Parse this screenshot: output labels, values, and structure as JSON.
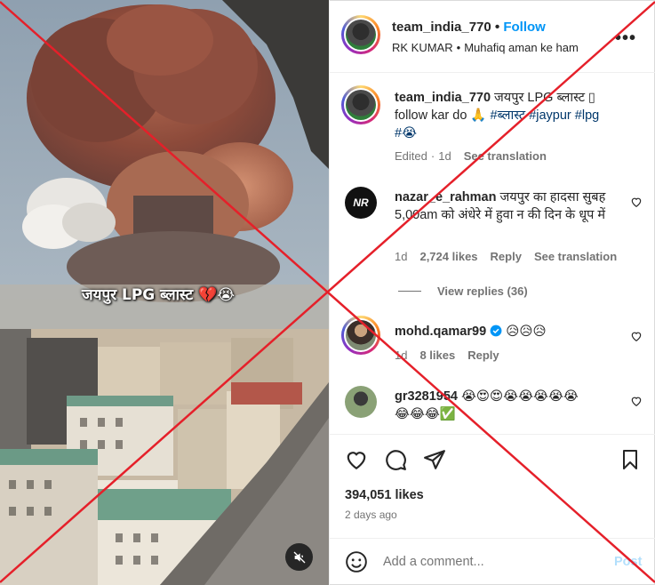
{
  "media": {
    "overlay_caption": "जयपुर LPG ब्लास्ट 💔😭",
    "mute_icon": "speaker-muted-icon"
  },
  "post": {
    "username": "team_india_770",
    "follow_label": "Follow",
    "subtitle_name": "RK KUMAR",
    "subtitle_text": "Muhafiq aman ke ham",
    "more_label": "•••"
  },
  "caption": {
    "username": "team_india_770",
    "text_part1": "जयपुर LPG ब्लास्ट ▯",
    "text_part2": "follow kar do 🙏",
    "hashtags": [
      "#ब्लास्ट",
      "#jaypur",
      "#lpg",
      "#😭"
    ],
    "edited": "Edited",
    "time": "1d",
    "see_translation": "See translation"
  },
  "comments": [
    {
      "username": "nazar_e_rahman",
      "text": "जयपुर का हादसा सुबह 5,00am को अंधेरे में हुवा न की दिन के धूप में",
      "time": "1d",
      "likes": "2,724 likes",
      "reply": "Reply",
      "see_translation": "See translation",
      "view_replies": "View replies (36)"
    },
    {
      "username": "mohd.qamar99",
      "verified": true,
      "text": "😥😥😥",
      "time": "1d",
      "likes": "8 likes",
      "reply": "Reply"
    },
    {
      "username": "gr3281954",
      "text_line1": "😭😍😍😭😭😭😭😭",
      "text_line2": "😂😂😂✅"
    }
  ],
  "actions": {
    "likes": "394,051 likes",
    "posted": "2 days ago",
    "comment_placeholder": "Add a comment...",
    "post_label": "Post"
  },
  "colors": {
    "accent": "#0095f6",
    "hashtag": "#00376b",
    "secondary_text": "#737373",
    "cross_overlay": "#e5202a"
  }
}
